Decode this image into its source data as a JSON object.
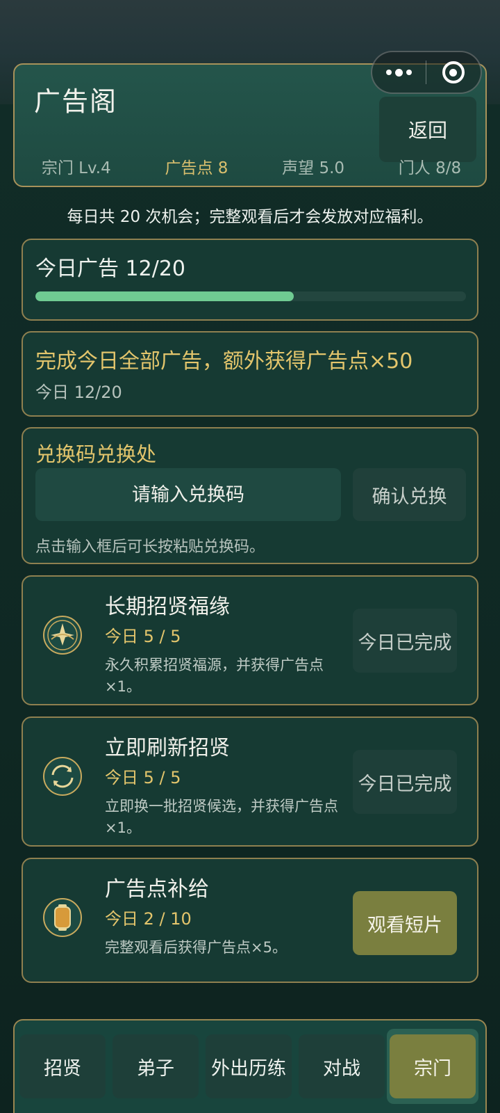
{
  "header": {
    "title": "广告阁",
    "back_label": "返回",
    "stats": [
      {
        "label": "宗门 Lv.4",
        "highlight": false
      },
      {
        "label": "广告点 8",
        "highlight": true
      },
      {
        "label": "声望 5.0",
        "highlight": false
      },
      {
        "label": "门人 8/8",
        "highlight": false
      }
    ]
  },
  "capsule": {
    "menu_icon": "more-dots-icon",
    "close_icon": "target-circle-icon"
  },
  "notice": "每日共 20 次机会；完整观看后才会发放对应福利。",
  "daily_ads": {
    "title": "今日广告 12/20",
    "done": 12,
    "total": 20
  },
  "bonus": {
    "title": "完成今日全部广告，额外获得广告点×50",
    "progress": "今日 12/20"
  },
  "redeem": {
    "title": "兑换码兑换处",
    "placeholder": "请输入兑换码",
    "button": "确认兑换",
    "hint": "点击输入框后可长按粘贴兑换码。"
  },
  "tasks": [
    {
      "icon": "star-emblem-icon",
      "name": "长期招贤福缘",
      "count": "今日 5 / 5",
      "desc": "永久积累招贤福源，并获得广告点×1。",
      "button": "今日已完成",
      "state": "done"
    },
    {
      "icon": "refresh-circle-icon",
      "name": "立即刷新招贤",
      "count": "今日 5 / 5",
      "desc": "立即换一批招贤候选，并获得广告点×1。",
      "button": "今日已完成",
      "state": "done"
    },
    {
      "icon": "lantern-icon",
      "name": "广告点补给",
      "count": "今日 2 / 10",
      "desc": "完整观看后获得广告点×5。",
      "button": "观看短片",
      "state": "active"
    }
  ],
  "nav": [
    {
      "label": "招贤",
      "active": false
    },
    {
      "label": "弟子",
      "active": false
    },
    {
      "label": "外出历练",
      "active": false
    },
    {
      "label": "对战",
      "active": false
    },
    {
      "label": "宗门",
      "active": true
    }
  ],
  "colors": {
    "accent_gold": "#e3c56c",
    "progress_green": "#6fcb92",
    "active_olive": "#7a7f3f",
    "border_gold": "#a8925a"
  }
}
